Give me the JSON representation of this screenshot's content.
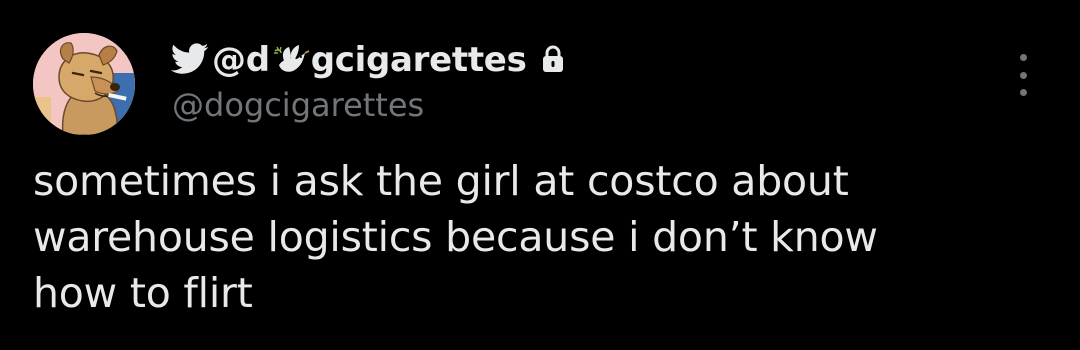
{
  "tweet": {
    "display_name_start": "@d",
    "display_name_end": "gcigarettes",
    "handle": "@dogcigarettes",
    "text_lines": [
      "sometimes i ask the girl at costco about",
      "warehouse logistics because i don’t know",
      "how to flirt"
    ]
  },
  "icons": {
    "brand": "twitter-bird-icon",
    "name_emoji": "dove-icon",
    "protected": "lock-icon",
    "menu": "more-options-icon"
  },
  "colors": {
    "background": "#000000",
    "primary_text": "#e7e9ea",
    "secondary_text": "#71767b"
  }
}
